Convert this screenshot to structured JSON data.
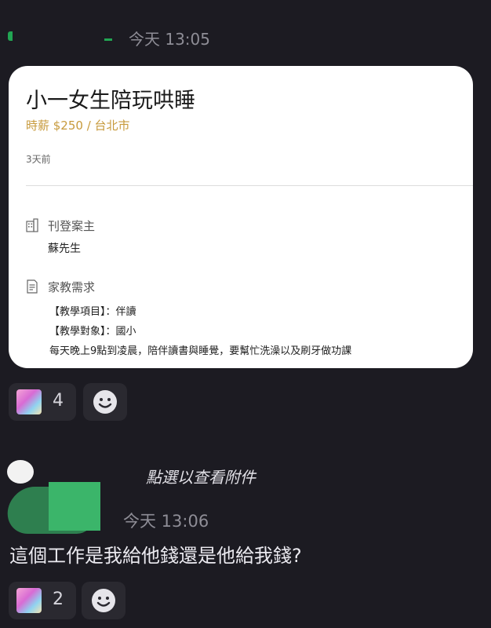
{
  "message1": {
    "time": "今天 13:05"
  },
  "job_card": {
    "title": "小一女生陪玩哄睡",
    "salary": "時薪 $250 / 台北市",
    "posted_ago": "3天前",
    "owner_label": "刊登案主",
    "owner_name": "蘇先生",
    "requirements_label": "家教需求",
    "requirement_lines": [
      "【教學項目】：伴讀",
      "【教學對象】：國小",
      "每天晚上9點到凌晨，陪伴讀書與睡覺，要幫忙洗澡以及刷牙做功課"
    ]
  },
  "reaction1": {
    "count": "4"
  },
  "message2": {
    "attachment_hint": "點選以查看附件",
    "time": "今天 13:06",
    "text": "這個工作是我給他錢還是他給我錢?"
  },
  "reaction2": {
    "count": "2"
  },
  "colors": {
    "background": "#1c1b22",
    "card": "#ffffff",
    "salary": "#c79a3c",
    "reaction_bg": "#2a2930"
  }
}
